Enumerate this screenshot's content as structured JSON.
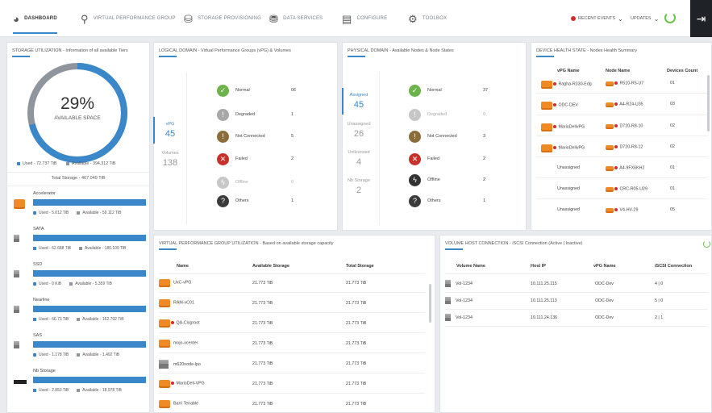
{
  "nav": {
    "tabs": [
      {
        "label": "DASHBOARD",
        "icon": "dashboard-gauge-icon"
      },
      {
        "label": "VIRTUAL PERFORMANCE GROUP",
        "icon": "hierarchy-icon"
      },
      {
        "label": "STORAGE PROVISIONING",
        "icon": "database-icon"
      },
      {
        "label": "DATA SERVICES",
        "icon": "data-services-icon"
      },
      {
        "label": "CONFIGURE",
        "icon": "configure-icon"
      },
      {
        "label": "TOOLBOX",
        "icon": "gear-icon"
      }
    ],
    "recent_events": "RECENT EVENTS",
    "updates": "UPDATES"
  },
  "storage": {
    "title": "STORAGE UTILIZATION - Information of all available Tiers",
    "percent": "29%",
    "percent_label": "AVAILABLE SPACE",
    "used_fraction": 0.71,
    "used_label": "Used - 72.737 TiB",
    "available_label": "Available - 394.312 TiB",
    "total_label": "Total Storage - 467.049 TiB",
    "colors": {
      "used": "#3a88c9",
      "available": "#8f959c"
    },
    "tiers": [
      {
        "name": "Accelerator",
        "icon": "drive-icon",
        "used": "Used - 5.012 TiB",
        "available": "Available - 59.112 TiB"
      },
      {
        "name": "SATA",
        "icon": "server-icon",
        "used": "Used - 62.688 TiB",
        "available": "Available - 180.109 TiB"
      },
      {
        "name": "SSD",
        "icon": "server-icon",
        "used": "Used - 0 KiB",
        "available": "Available - 5.359 TiB"
      },
      {
        "name": "Nearline",
        "icon": "server-icon",
        "used": "Used - 66.73 TiB",
        "available": "Available - 162.792 TiB"
      },
      {
        "name": "SAS",
        "icon": "server-icon",
        "used": "Used - 1.178 TiB",
        "available": "Available - 1.492 TiB"
      },
      {
        "name": "Nb Storage",
        "icon": "disk-icon",
        "used": "Used - 2.853 TiB",
        "available": "Available - 18.978 TiB"
      }
    ]
  },
  "logical": {
    "title": "LOGICAL DOMAIN - Virtual Performance Groups (vPG) & Volumes",
    "tabs": [
      {
        "label": "vPG",
        "count": "45"
      },
      {
        "label": "Volumes",
        "count": "138"
      }
    ],
    "states": [
      {
        "label": "Normal",
        "value": "06",
        "icon": "check-icon",
        "color": "#6bb34a"
      },
      {
        "label": "Degraded",
        "value": "1",
        "icon": "exclamation-icon",
        "color": "#a7a7a7"
      },
      {
        "label": "Not Connected",
        "value": "5",
        "icon": "not-connected-icon",
        "color": "#8a6d3b"
      },
      {
        "label": "Failed",
        "value": "2",
        "icon": "failed-icon",
        "color": "#c9302c"
      },
      {
        "label": "Offline",
        "value": "0",
        "icon": "offline-icon",
        "color": "#c7c7c7"
      },
      {
        "label": "Others",
        "value": "1",
        "icon": "question-icon",
        "color": "#3b3b3b"
      }
    ]
  },
  "physical": {
    "title": "PHYSICAL DOMAIN - Available Nodes & Node States",
    "tabs": [
      {
        "label": "Assigned",
        "count": "45"
      },
      {
        "label": "Unassigned",
        "count": "26"
      },
      {
        "label": "Unlicensed",
        "count": "4"
      },
      {
        "label": "Nb Storage",
        "count": "2"
      }
    ],
    "states": [
      {
        "label": "Normal",
        "value": "37",
        "icon": "check-icon",
        "color": "#6bb34a"
      },
      {
        "label": "Degraded",
        "value": "0",
        "icon": "exclamation-icon",
        "color": "#c7c7c7"
      },
      {
        "label": "Not Connected",
        "value": "3",
        "icon": "not-connected-icon",
        "color": "#8a6d3b"
      },
      {
        "label": "Failed",
        "value": "2",
        "icon": "failed-icon",
        "color": "#c9302c"
      },
      {
        "label": "Offline",
        "value": "2",
        "icon": "offline-icon",
        "color": "#333333"
      },
      {
        "label": "Others",
        "value": "1",
        "icon": "question-icon",
        "color": "#3b3b3b"
      }
    ]
  },
  "device_health": {
    "title": "DEVICE HEALTH STATE - Nodes Health Summary",
    "headers": [
      "vPG Name",
      "Node Name",
      "Devices Count"
    ],
    "rows": [
      {
        "vpg": "Ragha-R330-Edg",
        "node": "R510-R5-U7",
        "count": "01"
      },
      {
        "vpg": "ODC-DEV",
        "node": "A4-R24-U35",
        "count": "03"
      },
      {
        "vpg": "MarioDellvPG",
        "node": "D720-R8-10",
        "count": "02"
      },
      {
        "vpg": "MarioDellvPG",
        "node": "D720-R8-12",
        "count": "02"
      },
      {
        "vpg": "Unassigned",
        "node": "A4-9FX6KH2",
        "count": "01"
      },
      {
        "vpg": "Unassigned",
        "node": "CRC-R05-U29",
        "count": "01"
      },
      {
        "vpg": "Unassigned",
        "node": "V4-HV-29",
        "count": "05"
      }
    ]
  },
  "vpg_util": {
    "title": "VIRTUAL PERFORMANCE GROUP UTILIZATION - Based on available storage capacity",
    "headers": [
      "Name",
      "Available Storage",
      "Total Storage"
    ],
    "rows": [
      {
        "name": "UxC-vPG",
        "available": "21.773 TiB",
        "total": "21.773 TiB",
        "icon": "drive-icon"
      },
      {
        "name": "RAM-vC01",
        "available": "21.773 TiB",
        "total": "21.773 TiB",
        "icon": "drive-icon"
      },
      {
        "name": "QA-Cisgroot",
        "available": "21.773 TiB",
        "total": "21.773 TiB",
        "icon": "drive-alert-icon"
      },
      {
        "name": "mojo-vcenter",
        "available": "21.773 TiB",
        "total": "21.773 TiB",
        "icon": "drive-icon"
      },
      {
        "name": "m620node-lpo",
        "available": "21.773 TiB",
        "total": "21.773 TiB",
        "icon": "server-icon"
      },
      {
        "name": "MarioDell-VPG",
        "available": "21.773 TiB",
        "total": "21.773 TiB",
        "icon": "drive-alert-icon"
      },
      {
        "name": "Barri Tenable",
        "available": "21.773 TiB",
        "total": "21.773 TiB",
        "icon": "drive-icon"
      }
    ]
  },
  "volume_host": {
    "title": "VOLUME HOST CONNECTION - iSCSI Connection (Active | Inactive)",
    "headers": [
      "Volume Name",
      "Host IP",
      "vPG Name",
      "iSCSI Connection"
    ],
    "rows": [
      {
        "volume": "Vol-1234",
        "ip": "10.111.25.115",
        "vpg": "ODC-Dev",
        "conn": "4 | 0"
      },
      {
        "volume": "Vol-1234",
        "ip": "10.111.25.113",
        "vpg": "ODC-Dev",
        "conn": "5 | 0"
      },
      {
        "volume": "Vol-1234",
        "ip": "10.111.24.136",
        "vpg": "ODC-Dev",
        "conn": "2 | 1"
      }
    ]
  }
}
